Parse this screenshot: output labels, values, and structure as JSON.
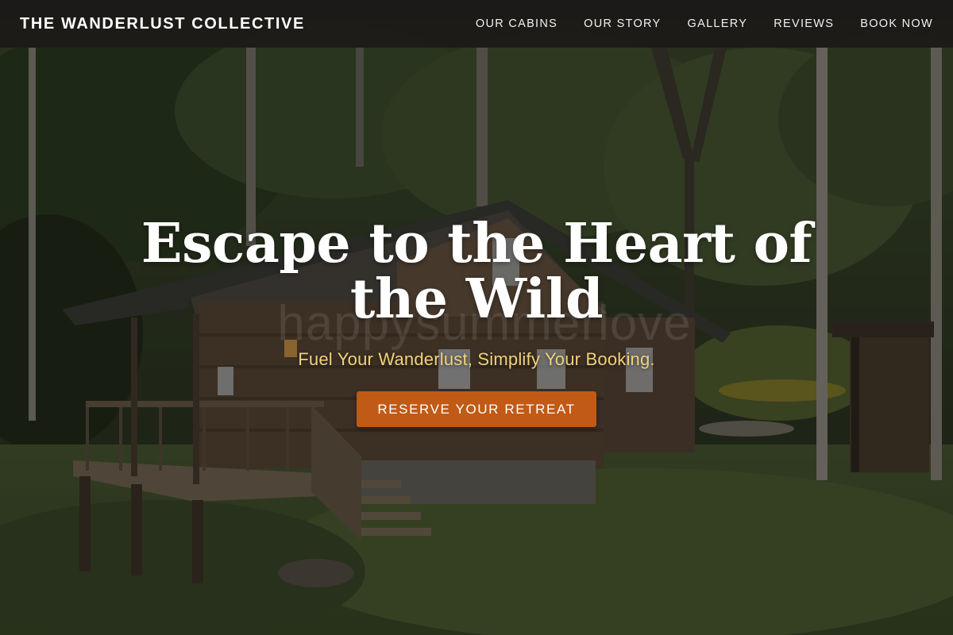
{
  "navbar": {
    "brand": "THE WANDERLUST COLLECTIVE",
    "links": [
      {
        "label": "OUR CABINS"
      },
      {
        "label": "OUR STORY"
      },
      {
        "label": "GALLERY"
      },
      {
        "label": "REVIEWS"
      },
      {
        "label": "BOOK NOW"
      }
    ]
  },
  "hero": {
    "title": "Escape to the Heart of the Wild",
    "watermark": "happysummerlove",
    "subtitle": "Fuel Your Wanderlust, Simplify Your Booking.",
    "cta_label": "RESERVE YOUR RETREAT",
    "background": "forest-cabin-photo"
  },
  "colors": {
    "nav_background": "#1c1a18",
    "cta_background": "#c05a16",
    "subtitle_color": "#f0d27a",
    "text": "#ffffff"
  }
}
